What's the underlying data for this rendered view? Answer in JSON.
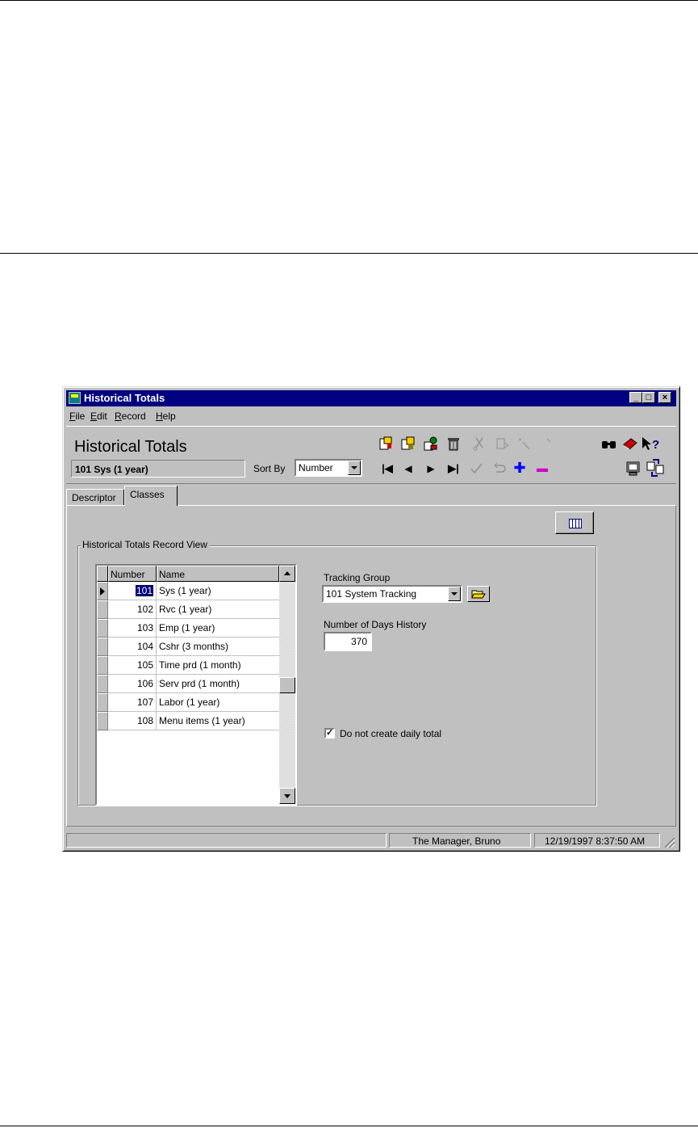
{
  "window": {
    "title": "Historical Totals",
    "controls": [
      "_",
      "□",
      "×"
    ]
  },
  "menu": [
    {
      "mnemonic": "F",
      "rest": "ile"
    },
    {
      "mnemonic": "E",
      "rest": "dit"
    },
    {
      "mnemonic": "R",
      "rest": "ecord"
    },
    {
      "mnemonic": "H",
      "rest": "elp"
    }
  ],
  "header": {
    "title": "Historical Totals",
    "current_record": "101 Sys (1 year)",
    "sort_by_label": "Sort By",
    "sort_by_value": "Number"
  },
  "toolbar": {
    "glyphs": {
      "first": "|◀",
      "prev": "◀",
      "next": "▶",
      "last": "▶|",
      "add": "✚",
      "delete": "▬",
      "find": "👓",
      "help": "➚?"
    }
  },
  "tabs": [
    {
      "label": "Descriptor",
      "active": false
    },
    {
      "label": "Classes",
      "active": true
    }
  ],
  "group": {
    "title": "Historical Totals Record View"
  },
  "table": {
    "columns": [
      "Number",
      "Name"
    ],
    "rows": [
      {
        "number": "101",
        "name": "Sys (1 year)"
      },
      {
        "number": "102",
        "name": "Rvc (1 year)"
      },
      {
        "number": "103",
        "name": "Emp (1 year)"
      },
      {
        "number": "104",
        "name": "Cshr (3 months)"
      },
      {
        "number": "105",
        "name": "Time prd (1 month)"
      },
      {
        "number": "106",
        "name": "Serv prd (1 month)"
      },
      {
        "number": "107",
        "name": "Labor (1 year)"
      },
      {
        "number": "108",
        "name": "Menu items (1 year)"
      }
    ],
    "selected_row": 0
  },
  "form": {
    "tracking_group_label": "Tracking Group",
    "tracking_group_value": "101  System Tracking",
    "days_history_label": "Number of Days History",
    "days_history_value": "370",
    "no_daily_total_label": "Do not create daily total",
    "no_daily_total_checked": true,
    "check_glyph": "✓"
  },
  "status": {
    "message": "",
    "user": "The Manager, Bruno",
    "datetime": "12/19/1997 8:37:50 AM"
  },
  "colors": {
    "title_bar": "#000080",
    "face": "#c0c0c0",
    "add_icon": "#0000ff",
    "delete_icon": "#cc00cc"
  }
}
